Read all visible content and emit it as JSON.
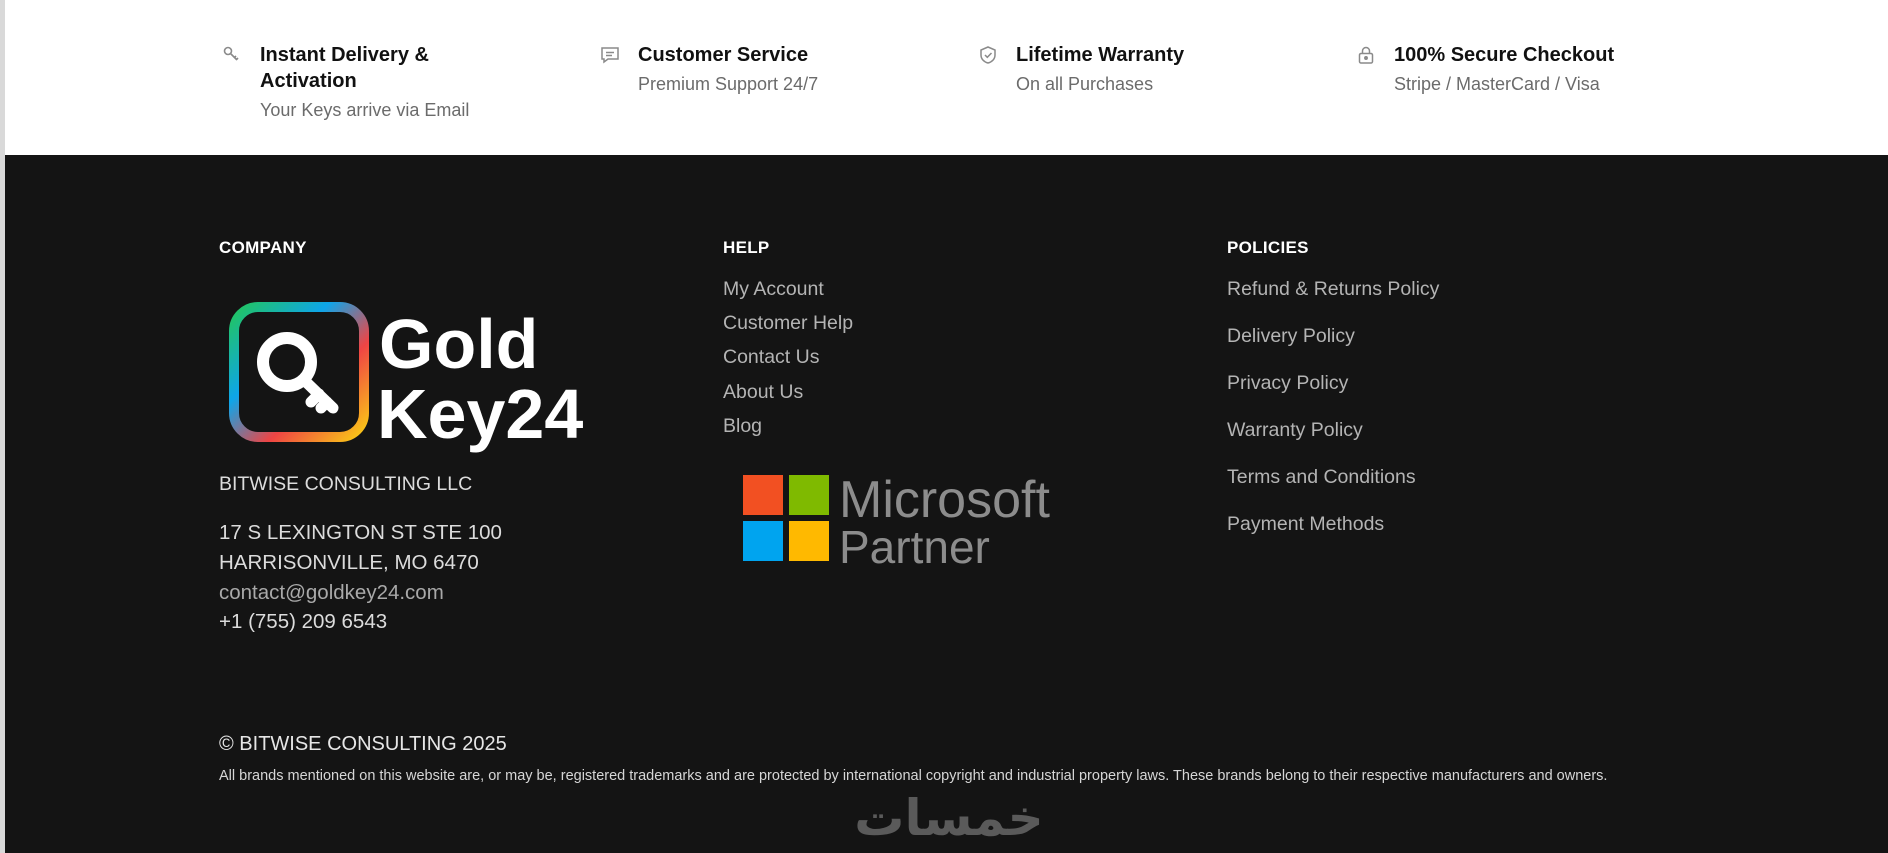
{
  "features": [
    {
      "icon": "key-icon",
      "title": "Instant Delivery & Activation",
      "subtitle": "Your Keys arrive via Email"
    },
    {
      "icon": "chat-icon",
      "title": "Customer Service",
      "subtitle": "Premium Support 24/7"
    },
    {
      "icon": "shield-check-icon",
      "title": "Lifetime Warranty",
      "subtitle": "On all Purchases"
    },
    {
      "icon": "lock-icon",
      "title": "100% Secure Checkout",
      "subtitle": "Stripe / MasterCard / Visa"
    }
  ],
  "footer": {
    "company": {
      "title": "COMPANY",
      "logo_text_1": "Gold",
      "logo_text_2": "Key24",
      "name": "BITWISE CONSULTING LLC",
      "address_1": "17 S LEXINGTON ST STE 100",
      "address_2": "HARRISONVILLE, MO 6470",
      "email": "contact@goldkey24.com",
      "phone": "+1 (755) 209 6543"
    },
    "help": {
      "title": "HELP",
      "links": [
        "My Account",
        "Customer Help",
        "Contact Us",
        "About Us",
        "Blog"
      ],
      "partner_1": "Microsoft",
      "partner_2": "Partner"
    },
    "policies": {
      "title": "POLICIES",
      "links": [
        "Refund & Returns Policy",
        "Delivery Policy",
        "Privacy Policy",
        "Warranty Policy",
        "Terms and Conditions",
        "Payment Methods"
      ]
    },
    "copyright": "© BITWISE CONSULTING 2025",
    "disclaimer": "All brands mentioned on this website are, or may be, registered trademarks and are protected by international copyright and industrial property laws. These brands belong to their respective manufacturers and owners.",
    "watermark": "خمسات"
  },
  "colors": {
    "footer_bg": "#141414",
    "ms_red": "#F25022",
    "ms_green": "#7FBA00",
    "ms_blue": "#00A4EF",
    "ms_yellow": "#FFB900"
  }
}
